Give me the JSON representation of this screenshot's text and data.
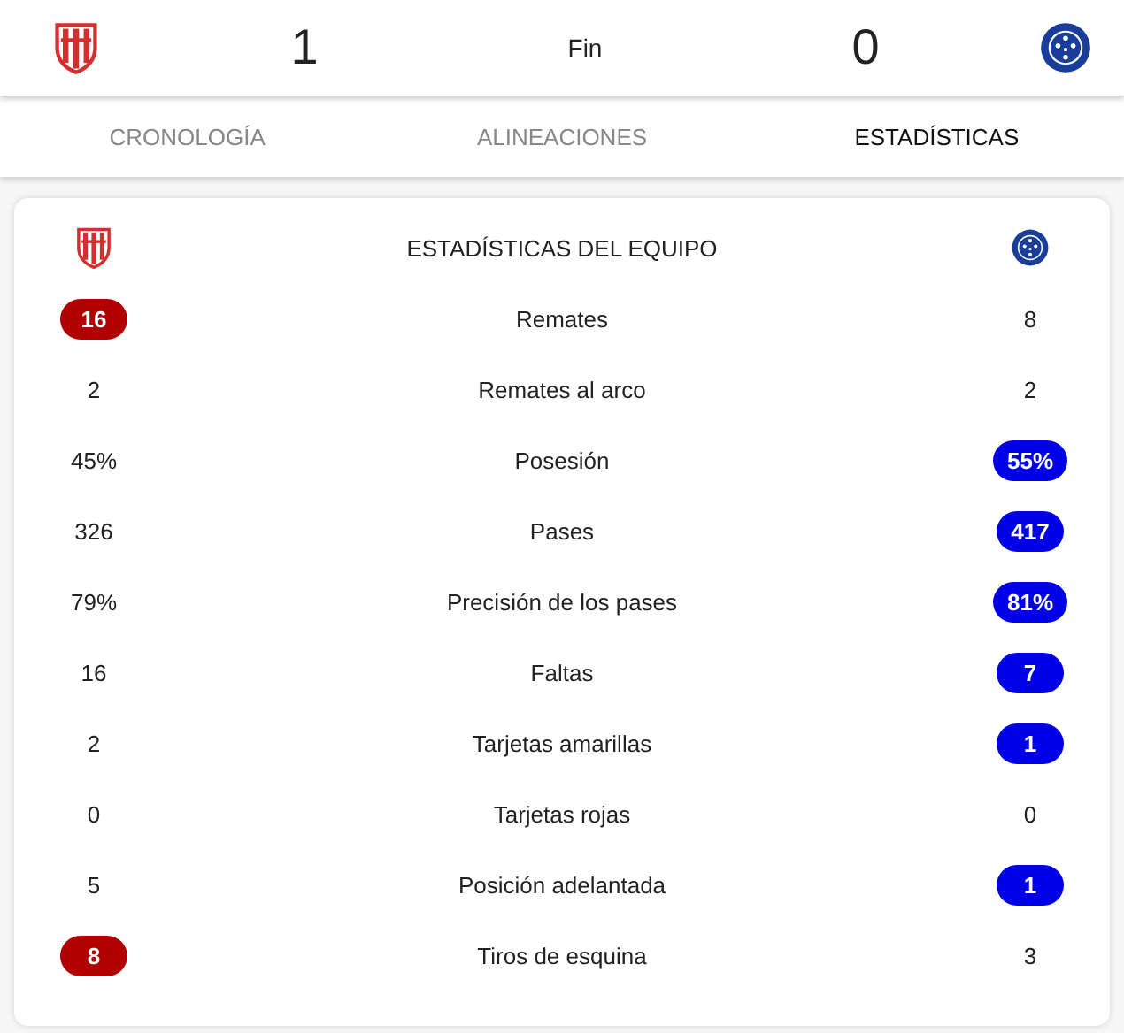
{
  "match": {
    "home_score": "1",
    "status": "Fin",
    "away_score": "0"
  },
  "tabs": [
    {
      "label": "CRONOLOGÍA",
      "selected": false
    },
    {
      "label": "ALINEACIONES",
      "selected": false
    },
    {
      "label": "ESTADÍSTICAS",
      "selected": true
    }
  ],
  "stats": {
    "title": "ESTADÍSTICAS DEL EQUIPO",
    "rows": [
      {
        "label": "Remates",
        "home": "16",
        "away": "8",
        "home_highlighted": true,
        "away_highlighted": false
      },
      {
        "label": "Remates al arco",
        "home": "2",
        "away": "2",
        "home_highlighted": false,
        "away_highlighted": false
      },
      {
        "label": "Posesión",
        "home": "45%",
        "away": "55%",
        "home_highlighted": false,
        "away_highlighted": true
      },
      {
        "label": "Pases",
        "home": "326",
        "away": "417",
        "home_highlighted": false,
        "away_highlighted": true
      },
      {
        "label": "Precisión de los pases",
        "home": "79%",
        "away": "81%",
        "home_highlighted": false,
        "away_highlighted": true
      },
      {
        "label": "Faltas",
        "home": "16",
        "away": "7",
        "home_highlighted": false,
        "away_highlighted": true
      },
      {
        "label": "Tarjetas amarillas",
        "home": "2",
        "away": "1",
        "home_highlighted": false,
        "away_highlighted": true
      },
      {
        "label": "Tarjetas rojas",
        "home": "0",
        "away": "0",
        "home_highlighted": false,
        "away_highlighted": false
      },
      {
        "label": "Posición adelantada",
        "home": "5",
        "away": "1",
        "home_highlighted": false,
        "away_highlighted": true
      },
      {
        "label": "Tiros de esquina",
        "home": "8",
        "away": "3",
        "home_highlighted": true,
        "away_highlighted": false
      }
    ]
  }
}
